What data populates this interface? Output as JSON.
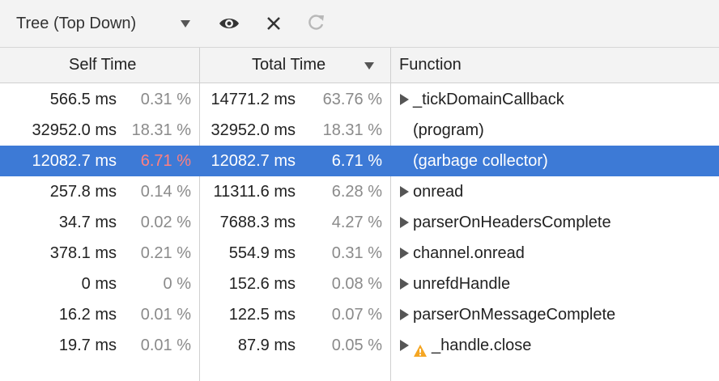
{
  "toolbar": {
    "view_mode": "Tree (Top Down)",
    "icons": [
      "dropdown-arrow-icon",
      "eye-icon",
      "close-icon",
      "reload-icon"
    ]
  },
  "columns": {
    "self_time": "Self Time",
    "total_time": "Total Time",
    "function": "Function"
  },
  "rows": [
    {
      "self_ms": "566.5 ms",
      "self_pct": "0.31 %",
      "total_ms": "14771.2 ms",
      "total_pct": "63.76 %",
      "function": "_tickDomainCallback",
      "expandable": true,
      "warning": false,
      "selected": false
    },
    {
      "self_ms": "32952.0 ms",
      "self_pct": "18.31 %",
      "total_ms": "32952.0 ms",
      "total_pct": "18.31 %",
      "function": "(program)",
      "expandable": false,
      "warning": false,
      "selected": false
    },
    {
      "self_ms": "12082.7 ms",
      "self_pct": "6.71 %",
      "total_ms": "12082.7 ms",
      "total_pct": "6.71 %",
      "function": "(garbage collector)",
      "expandable": false,
      "warning": false,
      "selected": true
    },
    {
      "self_ms": "257.8 ms",
      "self_pct": "0.14 %",
      "total_ms": "11311.6 ms",
      "total_pct": "6.28 %",
      "function": "onread",
      "expandable": true,
      "warning": false,
      "selected": false
    },
    {
      "self_ms": "34.7 ms",
      "self_pct": "0.02 %",
      "total_ms": "7688.3 ms",
      "total_pct": "4.27 %",
      "function": "parserOnHeadersComplete",
      "expandable": true,
      "warning": false,
      "selected": false
    },
    {
      "self_ms": "378.1 ms",
      "self_pct": "0.21 %",
      "total_ms": "554.9 ms",
      "total_pct": "0.31 %",
      "function": "channel.onread",
      "expandable": true,
      "warning": false,
      "selected": false
    },
    {
      "self_ms": "0 ms",
      "self_pct": "0 %",
      "total_ms": "152.6 ms",
      "total_pct": "0.08 %",
      "function": "unrefdHandle",
      "expandable": true,
      "warning": false,
      "selected": false
    },
    {
      "self_ms": "16.2 ms",
      "self_pct": "0.01 %",
      "total_ms": "122.5 ms",
      "total_pct": "0.07 %",
      "function": "parserOnMessageComplete",
      "expandable": true,
      "warning": false,
      "selected": false
    },
    {
      "self_ms": "19.7 ms",
      "self_pct": "0.01 %",
      "total_ms": "87.9 ms",
      "total_pct": "0.05 %",
      "function": "_handle.close",
      "expandable": true,
      "warning": true,
      "selected": false
    }
  ],
  "colors": {
    "selection": "#3d7ad6",
    "selected_self_pct": "#ff8080",
    "muted_pct": "#8a8a8a",
    "warning": "#f5a623"
  }
}
